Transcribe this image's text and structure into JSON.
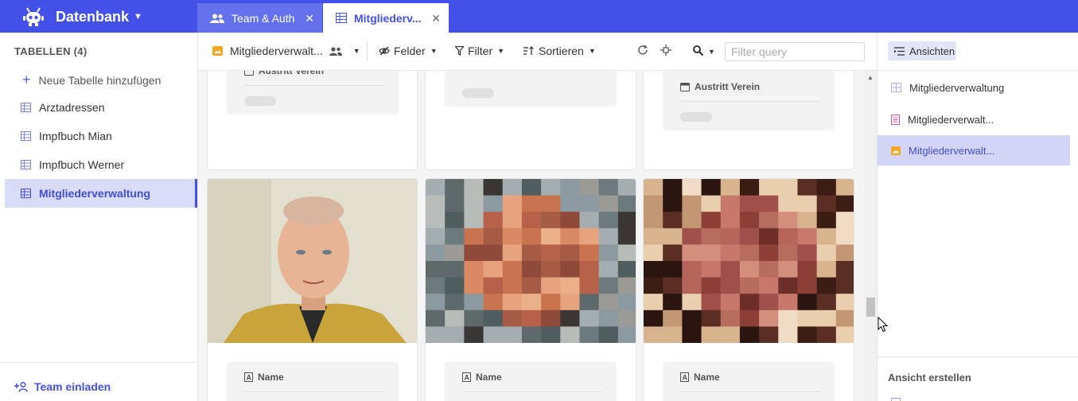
{
  "app": {
    "title": "Datenbank",
    "logo_icon": "robot-logo-icon"
  },
  "tabs": [
    {
      "label": "Team & Auth",
      "icon": "users-icon",
      "active": false
    },
    {
      "label": "Mitgliederv...",
      "icon": "grid-icon",
      "active": true
    }
  ],
  "sidebar": {
    "heading": "TABELLEN (4)",
    "add_label": "Neue Tabelle hinzufügen",
    "items": [
      {
        "label": "Arztadressen",
        "active": false
      },
      {
        "label": "Impfbuch Mian",
        "active": false
      },
      {
        "label": "Impfbuch Werner",
        "active": false
      },
      {
        "label": "Mitgliederverwaltung",
        "active": true
      }
    ],
    "invite_label": "Team einladen"
  },
  "toolbar": {
    "view_label": "Mitgliederverwalt...",
    "fields_label": "Felder",
    "filter_label": "Filter",
    "sort_label": "Sortieren",
    "search_placeholder": "Filter query"
  },
  "gallery": {
    "field_austritt": "Austritt Verein",
    "field_name": "Name"
  },
  "right_panel": {
    "button_label": "Ansichten",
    "views": [
      {
        "label": "Mitgliederverwaltung",
        "type": "grid",
        "active": false
      },
      {
        "label": "Mitgliederverwalt...",
        "type": "form",
        "active": false
      },
      {
        "label": "Mitgliederverwalt...",
        "type": "gallery",
        "active": true
      }
    ],
    "create_label": "Ansicht erstellen"
  },
  "colors": {
    "primary": "#4351e8",
    "tab_inactive": "#6470ec",
    "active_row": "#d9dcf8",
    "gallery_icon": "#f5a623",
    "form_icon": "#e0569a"
  }
}
